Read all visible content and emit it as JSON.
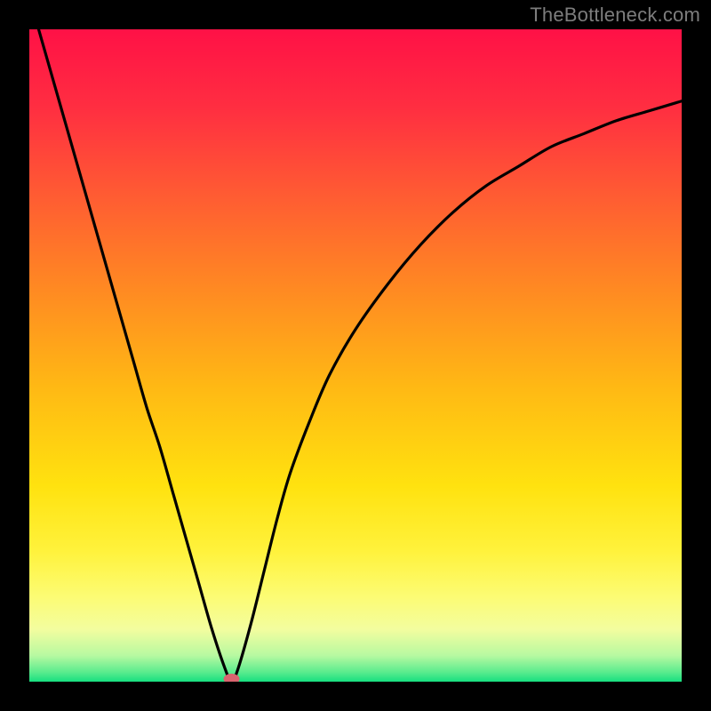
{
  "watermark": {
    "text": "TheBottleneck.com"
  },
  "chart_data": {
    "type": "line",
    "title": "",
    "xlabel": "",
    "ylabel": "",
    "xlim": [
      0,
      100
    ],
    "ylim": [
      0,
      100
    ],
    "series": [
      {
        "name": "bottleneck-curve",
        "x": [
          0,
          2,
          4,
          6,
          8,
          10,
          12,
          14,
          16,
          18,
          20,
          22,
          24,
          26,
          28,
          30,
          31,
          32,
          34,
          36,
          38,
          40,
          43,
          46,
          50,
          55,
          60,
          65,
          70,
          75,
          80,
          85,
          90,
          95,
          100
        ],
        "y": [
          105,
          98,
          91,
          84,
          77,
          70,
          63,
          56,
          49,
          42,
          36,
          29,
          22,
          15,
          8,
          2,
          0,
          2,
          9,
          17,
          25,
          32,
          40,
          47,
          54,
          61,
          67,
          72,
          76,
          79,
          82,
          84,
          86,
          87.5,
          89
        ]
      }
    ],
    "marker": {
      "x": 31,
      "y": 0,
      "color": "#d9646f"
    },
    "gradient_stops": [
      {
        "offset": 0.0,
        "color": "#ff1146"
      },
      {
        "offset": 0.12,
        "color": "#ff2e41"
      },
      {
        "offset": 0.25,
        "color": "#ff5a33"
      },
      {
        "offset": 0.4,
        "color": "#ff8a22"
      },
      {
        "offset": 0.55,
        "color": "#ffb914"
      },
      {
        "offset": 0.7,
        "color": "#ffe20f"
      },
      {
        "offset": 0.8,
        "color": "#fff23c"
      },
      {
        "offset": 0.87,
        "color": "#fcfc74"
      },
      {
        "offset": 0.92,
        "color": "#f3fd9f"
      },
      {
        "offset": 0.96,
        "color": "#b7f9a1"
      },
      {
        "offset": 0.985,
        "color": "#5cec8e"
      },
      {
        "offset": 1.0,
        "color": "#17df80"
      }
    ]
  }
}
